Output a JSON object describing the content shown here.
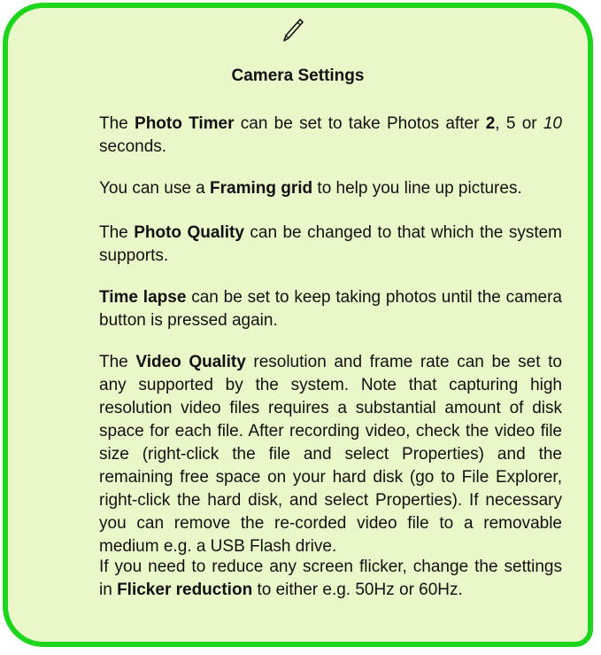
{
  "note": {
    "icon": "pen-icon",
    "title": "Camera Settings",
    "photo_timer": {
      "pre": "The ",
      "term": "Photo Timer",
      "mid": " can be set to take Photos after ",
      "opt1": "2",
      "sep1": ", ",
      "opt2": "5",
      "sep2": " or ",
      "opt3": "10",
      "post": " seconds."
    },
    "framing_grid": {
      "pre": "You can use a ",
      "term": "Framing grid",
      "post": " to help you line up pictures."
    },
    "photo_quality": {
      "pre": "The ",
      "term": "Photo Quality",
      "post": " can be changed to that which the system supports."
    },
    "time_lapse": {
      "term": "Time lapse",
      "post": " can be set to keep taking photos until the camera button is pressed again."
    },
    "video_quality": {
      "pre": "The ",
      "term": "Video Quality",
      "post": " resolution and frame rate can be set to any supported by the system. Note that capturing high resolution video files requires a substantial amount of disk space for each file. After recording video, check the video file size (right-click the file and select Properties) and the remaining free space on your hard disk (go to File Explorer, right-click the hard disk, and select Properties). If necessary you can remove the re-corded video file to a removable medium e.g. a USB Flash drive."
    },
    "flicker": {
      "pre": "If you need to reduce any screen flicker, change the settings in ",
      "term": "Flicker reduction",
      "post": " to either e.g. 50Hz or 60Hz."
    },
    "colors": {
      "border": "#1ed51e",
      "background": "#eaf7c9"
    }
  }
}
